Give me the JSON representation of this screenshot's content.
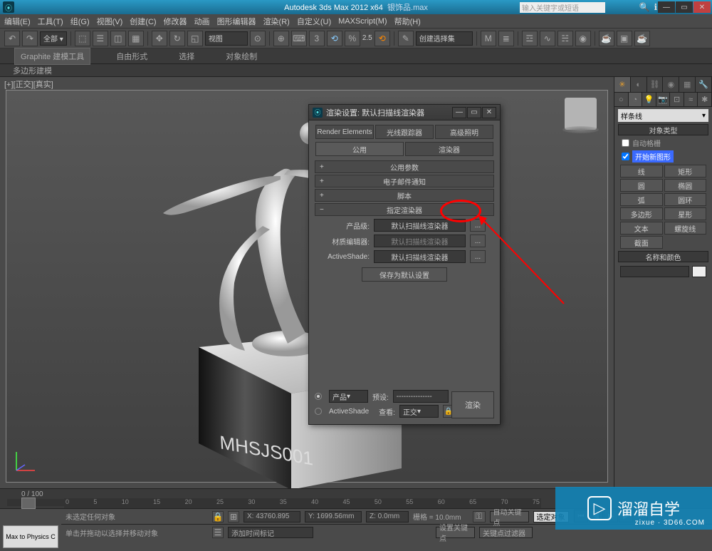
{
  "titlebar": {
    "app_title": "Autodesk 3ds Max 2012 x64",
    "filename": "银饰品.max",
    "search_placeholder": "输入关键字或短语"
  },
  "menubar": [
    "编辑(E)",
    "工具(T)",
    "组(G)",
    "视图(V)",
    "创建(C)",
    "修改器",
    "动画",
    "图形编辑器",
    "渲染(R)",
    "自定义(U)",
    "MAXScript(M)",
    "帮助(H)"
  ],
  "toolbar": {
    "all_dropdown": "全部 ▾",
    "view_label": "视图",
    "angle_val": "2.5",
    "selset": "创建选择集"
  },
  "ribbon": {
    "tabs": [
      "Graphite 建模工具",
      "自由形式",
      "选择",
      "对象绘制"
    ],
    "sub": "多边形建模"
  },
  "viewport": {
    "label": "[+][正交][真实]"
  },
  "dialog": {
    "title": "渲染设置: 默认扫描线渲染器",
    "tabs_row1": [
      "Render Elements",
      "光线跟踪器",
      "高级照明"
    ],
    "tabs_row2": [
      "公用",
      "渲染器"
    ],
    "rollouts": [
      "公用参数",
      "电子邮件通知",
      "脚本",
      "指定渲染器"
    ],
    "row_production": {
      "label": "产品级:",
      "value": "默认扫描线渲染器"
    },
    "row_material": {
      "label": "材质编辑器:",
      "value": "默认扫描线渲染器"
    },
    "row_active": {
      "label": "ActiveShade:",
      "value": "默认扫描线渲染器"
    },
    "save_default": "保存为默认设置",
    "bottom": {
      "product": "产品",
      "activeshade": "ActiveShade",
      "preset_label": "预设:",
      "preset_value": "---------------",
      "view_label": "查看:",
      "view_value": "正交",
      "render_btn": "渲染"
    }
  },
  "cmd_panel": {
    "category_dropdown": "样条线",
    "rollout_title": "对象类型",
    "autogrid": "自动格栅",
    "start_new": "开始新图形",
    "buttons": [
      [
        "线",
        "矩形"
      ],
      [
        "圆",
        "椭圆"
      ],
      [
        "弧",
        "圆环"
      ],
      [
        "多边形",
        "星形"
      ],
      [
        "文本",
        "螺旋线"
      ],
      [
        "截面",
        ""
      ]
    ],
    "name_rollout": "名称和颜色"
  },
  "status": {
    "frame": "0 / 100",
    "no_selection": "未选定任何对象",
    "prompt": "单击并拖动以选择并移动对象",
    "x": "X: 43760.895",
    "y": "Y: 1699.56mm",
    "z": "Z: 0.0mm",
    "grid": "栅格 = 10.0mm",
    "auto_key": "自动关键点",
    "sel_lock": "选定对象",
    "set_key": "设置关键点",
    "key_filter": "关键点过滤器",
    "add_time": "添加时间标记",
    "max_physics": "Max to Physics C"
  },
  "watermark": {
    "main": "溜溜自学",
    "sub": "zixue · 3D66.COM"
  },
  "timeline_ticks": [
    "0",
    "5",
    "10",
    "15",
    "20",
    "25",
    "30",
    "35",
    "40",
    "45",
    "50",
    "55",
    "60",
    "65",
    "70",
    "75"
  ]
}
